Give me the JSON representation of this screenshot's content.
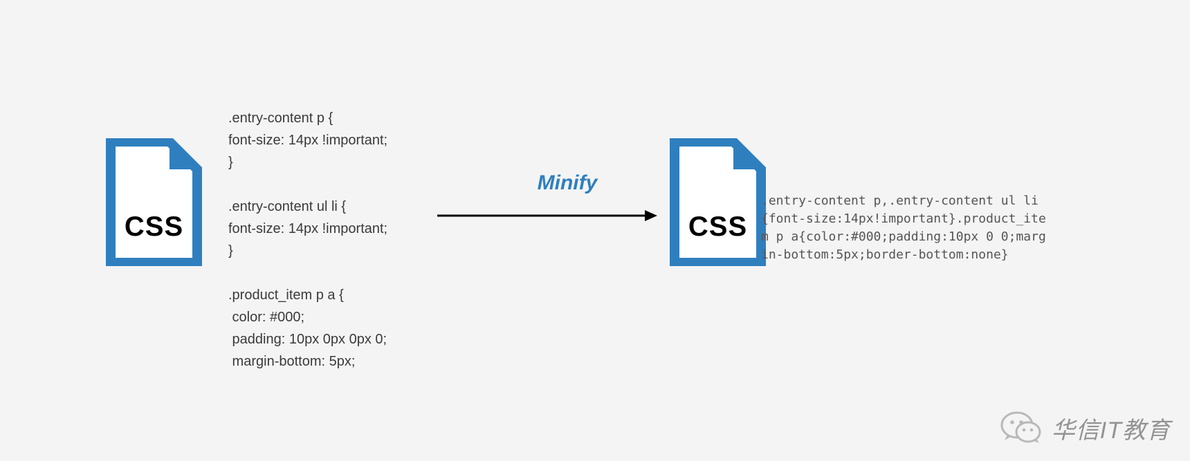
{
  "left_icon_label": "CSS",
  "right_icon_label": "CSS",
  "arrow_label": "Minify",
  "code_before": ".entry-content p {\nfont-size: 14px !important;\n}\n\n.entry-content ul li {\nfont-size: 14px !important;\n}\n\n.product_item p a {\n color: #000;\n padding: 10px 0px 0px 0;\n margin-bottom: 5px;",
  "code_after": ".entry-content p,.entry-content ul li {font-size:14px!important}.product_item p a{color:#000;padding:10px 0 0;margin-bottom:5px;border-bottom:none}",
  "watermark_text": "华信IT教育"
}
